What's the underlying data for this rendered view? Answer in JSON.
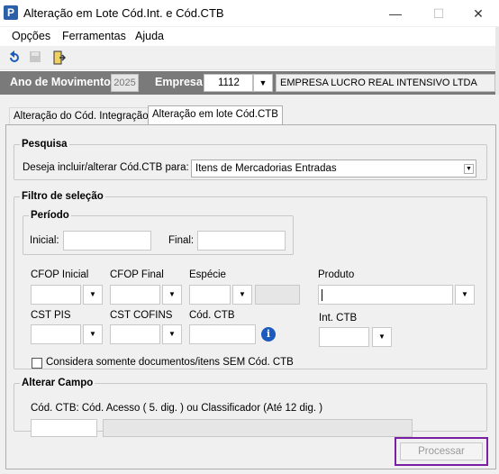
{
  "window": {
    "title": "Alteração em Lote Cód.Int. e Cód.CTB",
    "app_icon_letter": "P",
    "minimize": "—",
    "maximize": "☐",
    "close": "✕"
  },
  "menu": [
    "Opções",
    "Ferramentas",
    "Ajuda"
  ],
  "toolbar": {
    "icons": [
      "undo-icon",
      "save-icon",
      "exit-icon"
    ]
  },
  "header": {
    "ano_label": "Ano de Movimento",
    "ano_value": "2025",
    "empresa_label": "Empresa",
    "empresa_code": "1112",
    "empresa_name": "EMPRESA LUCRO REAL INTENSIVO LTDA"
  },
  "tabs": [
    "Alteração do Cód. Integração",
    "Alteração em lote Cód.CTB"
  ],
  "pesquisa": {
    "legend": "Pesquisa",
    "prompt": "Deseja incluir/alterar Cód.CTB para:",
    "selected": "Itens de Mercadorias Entradas"
  },
  "filtro": {
    "legend": "Filtro de seleção",
    "periodo_legend": "Período",
    "inicial_label": "Inicial:",
    "final_label": "Final:",
    "cfop_inicial": "CFOP Inicial",
    "cfop_final": "CFOP Final",
    "especie": "Espécie",
    "produto": "Produto",
    "cst_pis": "CST PIS",
    "cst_cofins": "CST COFINS",
    "cod_ctb": "Cód. CTB",
    "int_ctb": "Int. CTB",
    "checkbox_label": "Considera somente documentos/itens SEM Cód. CTB"
  },
  "alterar": {
    "legend": "Alterar Campo",
    "hint": "Cód. CTB: Cód. Acesso ( 5. dig. ) ou Classificador (Até 12 dig. )"
  },
  "processar_label": "Processar"
}
